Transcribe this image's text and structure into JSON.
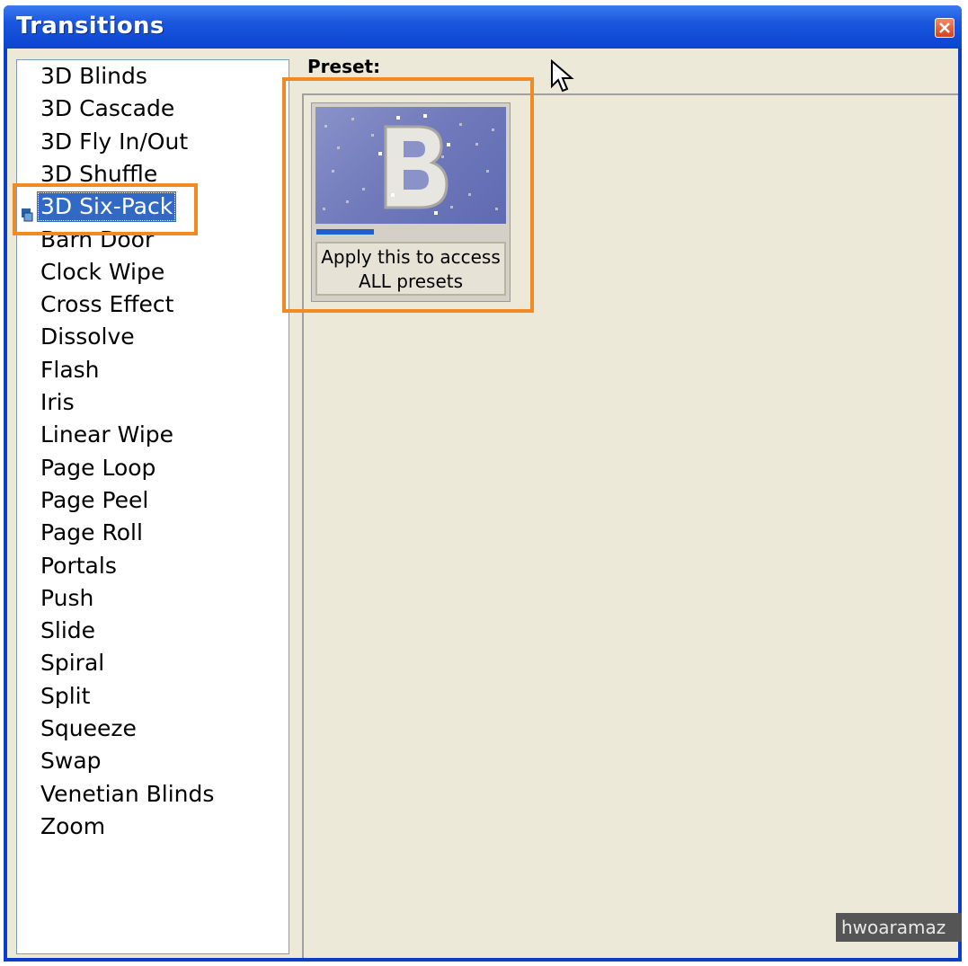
{
  "window": {
    "title": "Transitions"
  },
  "transitions": {
    "items": [
      "3D Blinds",
      "3D Cascade",
      "3D Fly In/Out",
      "3D Shuffle",
      "3D Six-Pack",
      "Barn Door",
      "Clock Wipe",
      "Cross Effect",
      "Dissolve",
      "Flash",
      "Iris",
      "Linear Wipe",
      "Page Loop",
      "Page Peel",
      "Page Roll",
      "Portals",
      "Push",
      "Slide",
      "Spiral",
      "Split",
      "Squeeze",
      "Swap",
      "Venetian Blinds",
      "Zoom"
    ],
    "selected": "3D Six-Pack"
  },
  "preset": {
    "label": "Preset:",
    "apply_line1": "Apply this to access",
    "apply_line2": "ALL presets",
    "progress_fraction": 0.3
  },
  "watermark": "hwoaramaz",
  "colors": {
    "highlight": "#f28a24",
    "selection": "#316ac5",
    "titlebar": "#0b45d0"
  }
}
